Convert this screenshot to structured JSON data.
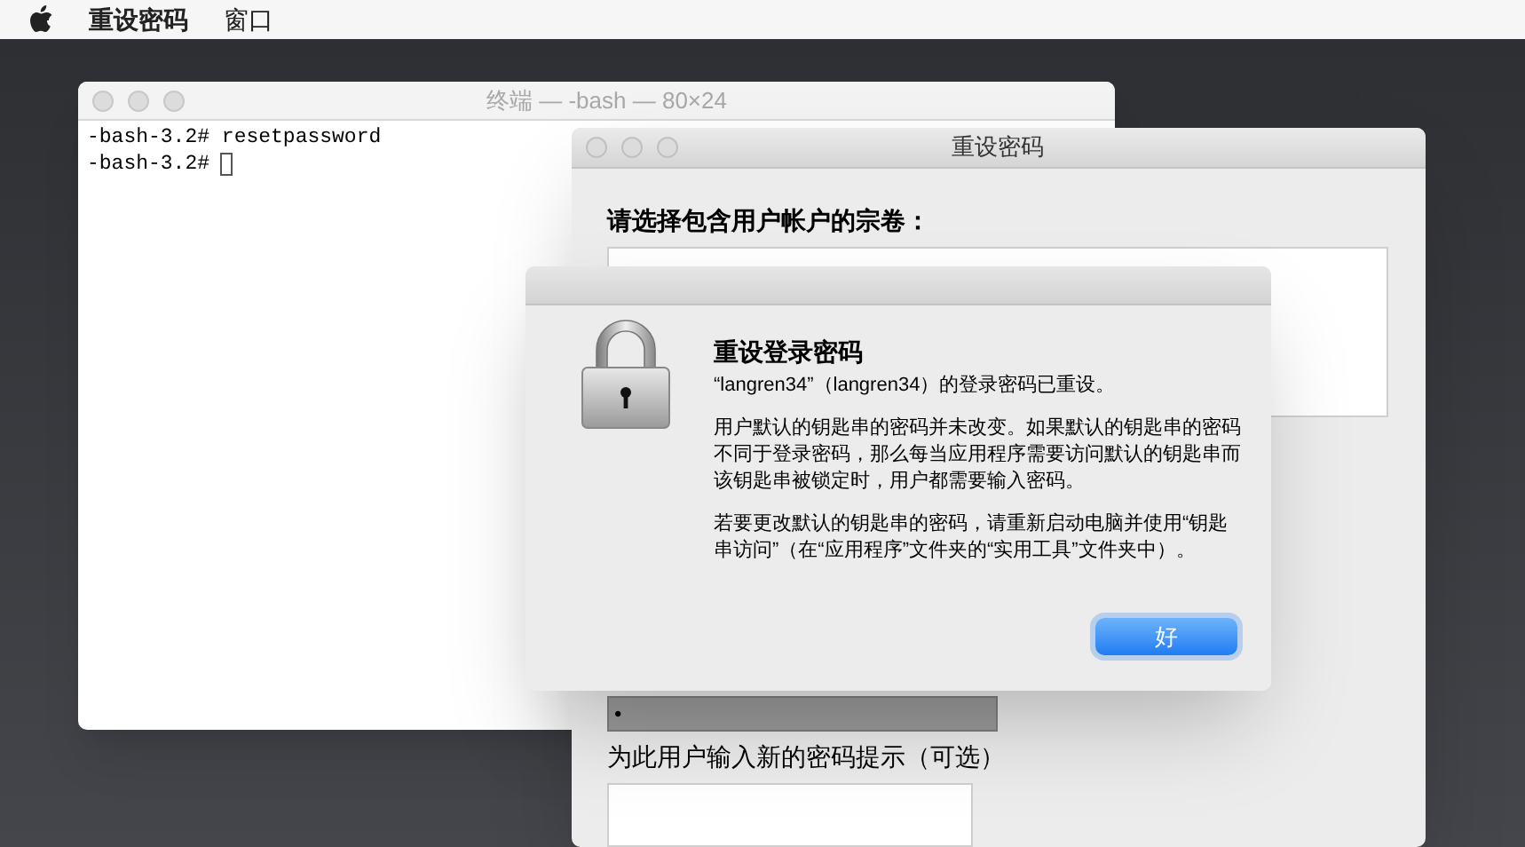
{
  "menu_bar": {
    "items": [
      {
        "label": "重设密码",
        "bold": true
      },
      {
        "label": "窗口",
        "bold": false
      }
    ]
  },
  "terminal": {
    "title": "终端 — -bash — 80×24",
    "lines": [
      "-bash-3.2# resetpassword",
      "-bash-3.2#"
    ]
  },
  "reset_window": {
    "title": "重设密码",
    "volume_label": "请选择包含用户帐户的宗卷：",
    "password_value": "•",
    "hint_label": "为此用户输入新的密码提示（可选）"
  },
  "alert": {
    "title": "重设登录密码",
    "paragraphs": [
      "“langren34”（langren34）的登录密码已重设。",
      "用户默认的钥匙串的密码并未改变。如果默认的钥匙串的密码不同于登录密码，那么每当应用程序需要访问默认的钥匙串而该钥匙串被锁定时，用户都需要输入密码。",
      "若要更改默认的钥匙串的密码，请重新启动电脑并使用“钥匙串访问”（在“应用程序”文件夹的“实用工具”文件夹中）。"
    ],
    "button": "好"
  }
}
